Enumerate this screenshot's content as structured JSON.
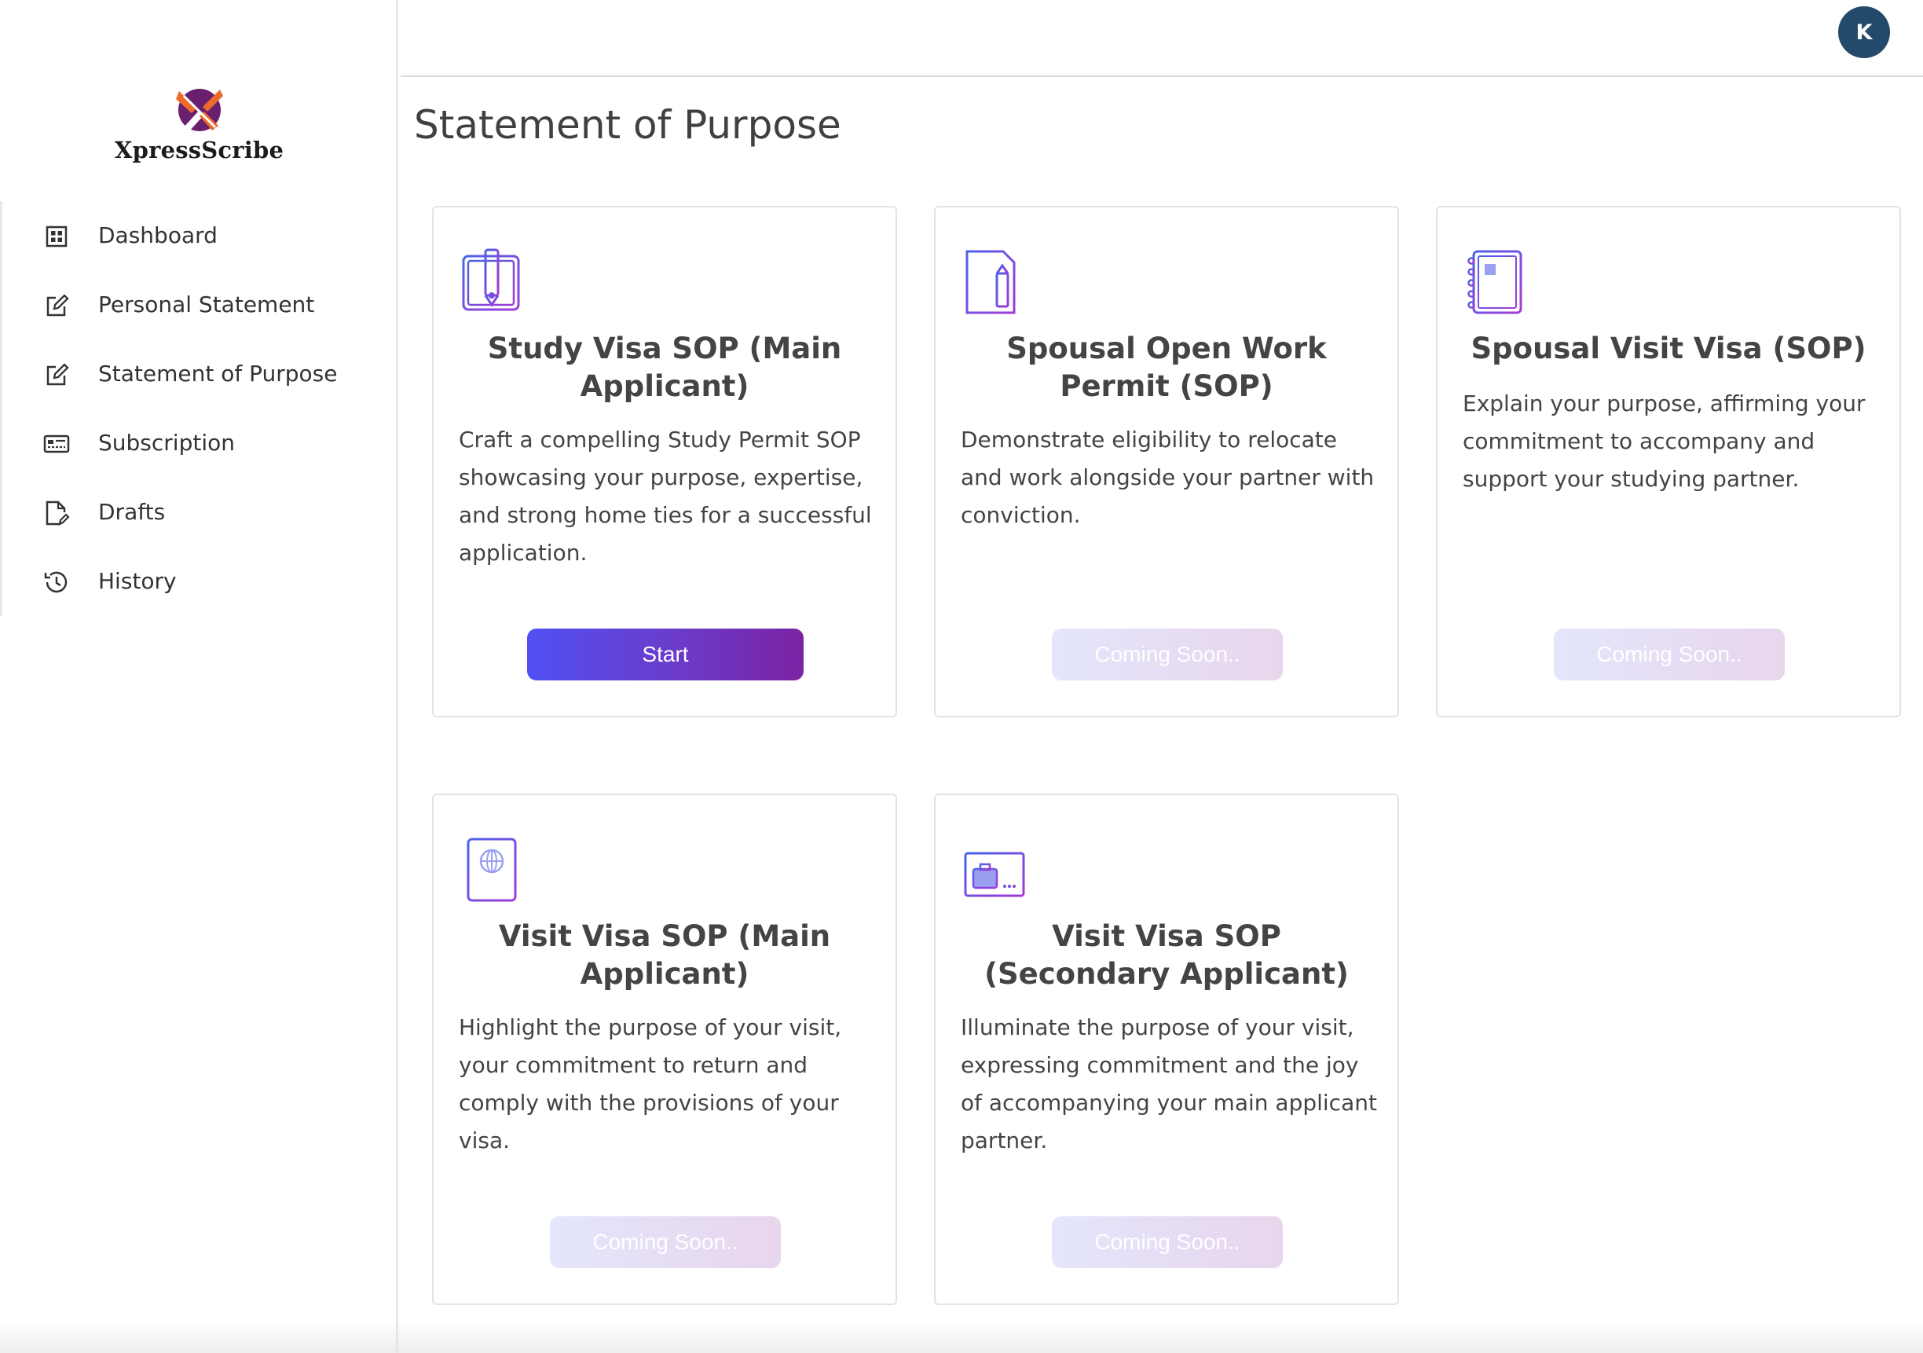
{
  "brand": {
    "name": "XpressScribe"
  },
  "user": {
    "avatar_initial": "K"
  },
  "sidebar": {
    "items": [
      {
        "label": "Dashboard",
        "icon": "grid-icon"
      },
      {
        "label": "Personal Statement",
        "icon": "edit-icon"
      },
      {
        "label": "Statement of Purpose",
        "icon": "edit-icon"
      },
      {
        "label": "Subscription",
        "icon": "id-card-icon"
      },
      {
        "label": "Drafts",
        "icon": "document-edit-icon"
      },
      {
        "label": "History",
        "icon": "history-icon"
      }
    ]
  },
  "page": {
    "title": "Statement of Purpose"
  },
  "cards": [
    {
      "title": "Study Visa SOP (Main Applicant)",
      "description": "Craft a compelling Study Permit SOP showcasing your purpose, expertise, and strong home ties for a successful application.",
      "button": "Start",
      "icon": "notebook-pencil-icon"
    },
    {
      "title": "Spousal Open Work Permit (SOP)",
      "description": "Demonstrate eligibility to relocate and work alongside your partner with conviction.",
      "button": "Coming Soon..",
      "icon": "document-pencil-icon"
    },
    {
      "title": "Spousal Visit Visa (SOP)",
      "description": "Explain your purpose, affirming your commitment to accompany and support your studying partner.",
      "button": "Coming Soon..",
      "icon": "spiral-notebook-icon"
    },
    {
      "title": "Visit Visa SOP (Main Applicant)",
      "description": "Highlight the purpose of your visit, your commitment to return and comply with the provisions of your visa.",
      "button": "Coming Soon..",
      "icon": "passport-icon"
    },
    {
      "title": "Visit Visa SOP (Secondary Applicant)",
      "description": "Illuminate the purpose of your visit, expressing commitment and the joy of accompanying your main applicant partner.",
      "button": "Coming Soon..",
      "icon": "luggage-ticket-icon"
    }
  ],
  "colors": {
    "accent_start": "#5150f2",
    "accent_end": "#7a23a3",
    "avatar_bg": "#23496b",
    "logo_purple": "#6a1f6e",
    "logo_orange": "#ee6a2a"
  }
}
